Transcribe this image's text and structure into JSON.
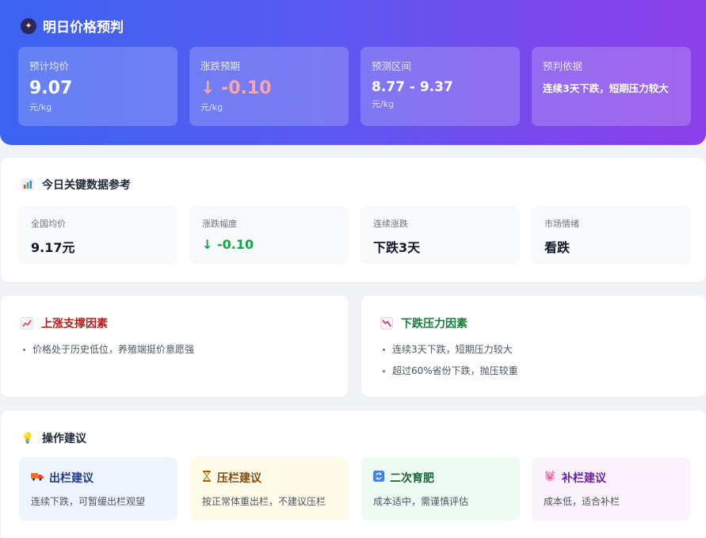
{
  "forecast": {
    "title": "明日价格预判",
    "icon": "fortune-teller-icon",
    "cards": [
      {
        "label": "预计均价",
        "value": "9.07",
        "unit": "元/kg"
      },
      {
        "label": "涨跌预期",
        "value": "↓ -0.10",
        "unit": "元/kg"
      },
      {
        "label": "预测区间",
        "value": "8.77 - 9.37",
        "unit": "元/kg"
      },
      {
        "label": "预判依据",
        "value": "连续3天下跌，短期压力较大"
      }
    ]
  },
  "key_data": {
    "title": "今日关键数据参考",
    "icon": "bar-chart-icon",
    "cards": [
      {
        "label": "全国均价",
        "value": "9.17元"
      },
      {
        "label": "涨跌幅度",
        "value": "↓ -0.10"
      },
      {
        "label": "连续涨跌",
        "value": "下跌3天"
      },
      {
        "label": "市场情绪",
        "value": "看跌"
      }
    ]
  },
  "up_factors": {
    "title": "上涨支撑因素",
    "icon": "trend-up-icon",
    "items": [
      "价格处于历史低位，养殖端挺价意愿强"
    ]
  },
  "down_factors": {
    "title": "下跌压力因素",
    "icon": "trend-down-icon",
    "items": [
      "连续3天下跌，短期压力较大",
      "超过60%省份下跌，抛压较重"
    ]
  },
  "advice": {
    "title": "操作建议",
    "icon": "lightbulb-icon",
    "cards": [
      {
        "title": "出栏建议",
        "icon": "truck-icon",
        "desc": "连续下跌，可暂缓出栏观望"
      },
      {
        "title": "压栏建议",
        "icon": "hourglass-icon",
        "desc": "按正常体重出栏，不建议压栏"
      },
      {
        "title": "二次育肥",
        "icon": "refresh-icon",
        "desc": "成本适中，需谨慎评估"
      },
      {
        "title": "补栏建议",
        "icon": "pig-icon",
        "desc": "成本低，适合补栏"
      }
    ]
  },
  "colors": {
    "hero_gradient_start": "#3b63f0",
    "hero_gradient_end": "#8b3fe8",
    "down_red": "#fca5a5",
    "down_green": "#16a34a"
  }
}
